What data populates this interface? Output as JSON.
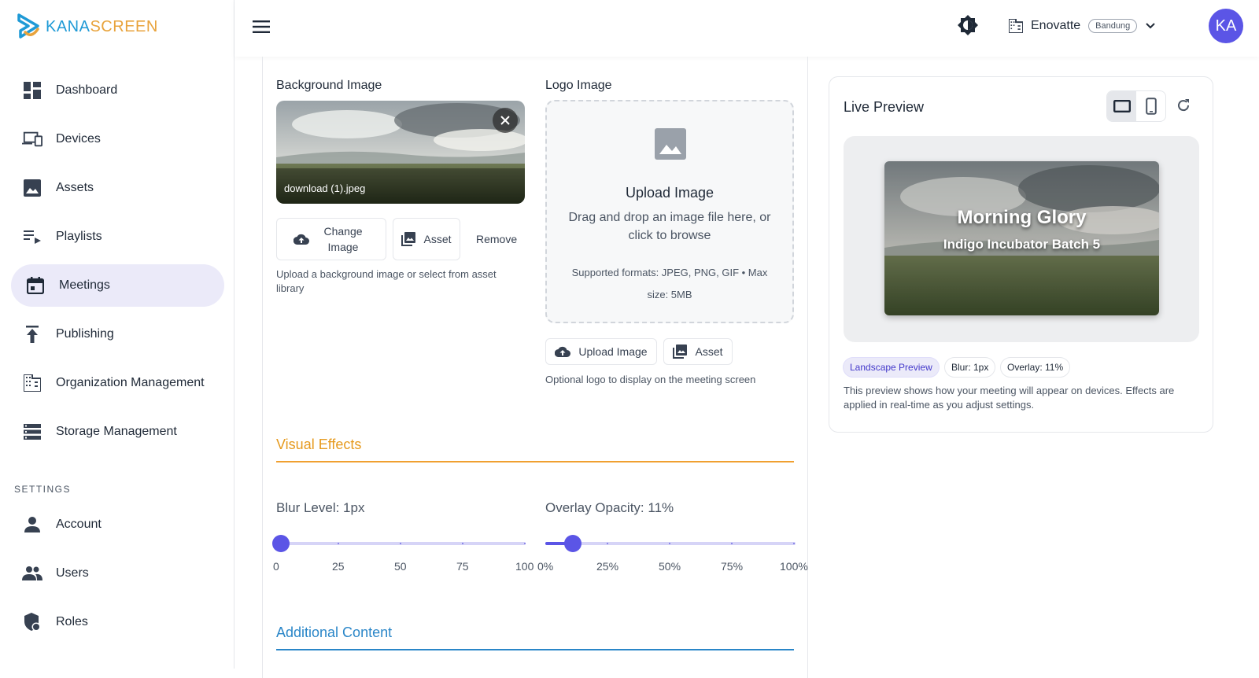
{
  "brand": {
    "name_part1": "KANA",
    "name_part2": "SCREEN"
  },
  "sidebar": {
    "items": [
      {
        "label": "Dashboard",
        "icon": "dashboard-icon"
      },
      {
        "label": "Devices",
        "icon": "devices-icon"
      },
      {
        "label": "Assets",
        "icon": "image-icon"
      },
      {
        "label": "Playlists",
        "icon": "playlist-icon"
      },
      {
        "label": "Meetings",
        "icon": "calendar-icon",
        "active": true
      },
      {
        "label": "Publishing",
        "icon": "publish-icon"
      },
      {
        "label": "Organization Management",
        "icon": "building-icon"
      },
      {
        "label": "Storage Management",
        "icon": "storage-icon"
      }
    ],
    "settings_heading": "SETTINGS",
    "settings_items": [
      {
        "label": "Account",
        "icon": "person-icon"
      },
      {
        "label": "Users",
        "icon": "group-icon"
      },
      {
        "label": "Roles",
        "icon": "shield-icon"
      }
    ]
  },
  "topbar": {
    "org_name": "Enovatte",
    "org_badge": "Bandung",
    "avatar_initials": "KA"
  },
  "background": {
    "label": "Background Image",
    "file_name": "download (1).jpeg",
    "change_label": "Change Image",
    "asset_label": "Asset",
    "remove_label": "Remove",
    "hint": "Upload a background image or select from asset library"
  },
  "logo": {
    "label": "Logo Image",
    "dropzone_title": "Upload Image",
    "dropzone_sub": "Drag and drop an image file here, or click to browse",
    "dropzone_formats": "Supported formats: JPEG, PNG, GIF • Max size: 5MB",
    "upload_label": "Upload Image",
    "asset_label": "Asset",
    "hint": "Optional logo to display on the meeting screen"
  },
  "visual_effects": {
    "title": "Visual Effects",
    "blur": {
      "label": "Blur Level: 1px",
      "value": 1,
      "max": 100,
      "marks": [
        "0",
        "25",
        "50",
        "75",
        "100"
      ]
    },
    "overlay": {
      "label": "Overlay Opacity: 11%",
      "value": 11,
      "max": 100,
      "marks": [
        "0%",
        "25%",
        "50%",
        "75%",
        "100%"
      ]
    }
  },
  "additional_content": {
    "title": "Additional Content"
  },
  "preview": {
    "title": "Live Preview",
    "meeting_title": "Morning Glory",
    "meeting_subtitle": "Indigo Incubator Batch 5",
    "chips": [
      "Landscape Preview",
      "Blur: 1px",
      "Overlay: 11%"
    ],
    "description": "This preview shows how your meeting will appear on devices. Effects are applied in real-time as you adjust settings."
  },
  "colors": {
    "accent": "#5b55e6",
    "effects": "#e69a1e",
    "additional": "#2a86c8"
  }
}
